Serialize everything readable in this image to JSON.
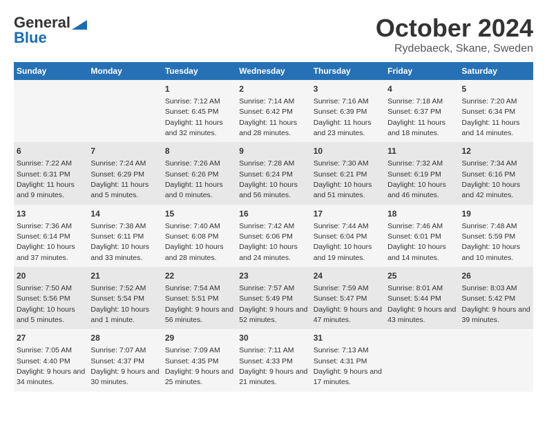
{
  "header": {
    "logo_general": "General",
    "logo_blue": "Blue",
    "month": "October 2024",
    "location": "Rydebaeck, Skane, Sweden"
  },
  "days_of_week": [
    "Sunday",
    "Monday",
    "Tuesday",
    "Wednesday",
    "Thursday",
    "Friday",
    "Saturday"
  ],
  "weeks": [
    [
      {
        "day": "",
        "info": ""
      },
      {
        "day": "",
        "info": ""
      },
      {
        "day": "1",
        "info": "Sunrise: 7:12 AM\nSunset: 6:45 PM\nDaylight: 11 hours and 32 minutes."
      },
      {
        "day": "2",
        "info": "Sunrise: 7:14 AM\nSunset: 6:42 PM\nDaylight: 11 hours and 28 minutes."
      },
      {
        "day": "3",
        "info": "Sunrise: 7:16 AM\nSunset: 6:39 PM\nDaylight: 11 hours and 23 minutes."
      },
      {
        "day": "4",
        "info": "Sunrise: 7:18 AM\nSunset: 6:37 PM\nDaylight: 11 hours and 18 minutes."
      },
      {
        "day": "5",
        "info": "Sunrise: 7:20 AM\nSunset: 6:34 PM\nDaylight: 11 hours and 14 minutes."
      }
    ],
    [
      {
        "day": "6",
        "info": "Sunrise: 7:22 AM\nSunset: 6:31 PM\nDaylight: 11 hours and 9 minutes."
      },
      {
        "day": "7",
        "info": "Sunrise: 7:24 AM\nSunset: 6:29 PM\nDaylight: 11 hours and 5 minutes."
      },
      {
        "day": "8",
        "info": "Sunrise: 7:26 AM\nSunset: 6:26 PM\nDaylight: 11 hours and 0 minutes."
      },
      {
        "day": "9",
        "info": "Sunrise: 7:28 AM\nSunset: 6:24 PM\nDaylight: 10 hours and 56 minutes."
      },
      {
        "day": "10",
        "info": "Sunrise: 7:30 AM\nSunset: 6:21 PM\nDaylight: 10 hours and 51 minutes."
      },
      {
        "day": "11",
        "info": "Sunrise: 7:32 AM\nSunset: 6:19 PM\nDaylight: 10 hours and 46 minutes."
      },
      {
        "day": "12",
        "info": "Sunrise: 7:34 AM\nSunset: 6:16 PM\nDaylight: 10 hours and 42 minutes."
      }
    ],
    [
      {
        "day": "13",
        "info": "Sunrise: 7:36 AM\nSunset: 6:14 PM\nDaylight: 10 hours and 37 minutes."
      },
      {
        "day": "14",
        "info": "Sunrise: 7:38 AM\nSunset: 6:11 PM\nDaylight: 10 hours and 33 minutes."
      },
      {
        "day": "15",
        "info": "Sunrise: 7:40 AM\nSunset: 6:08 PM\nDaylight: 10 hours and 28 minutes."
      },
      {
        "day": "16",
        "info": "Sunrise: 7:42 AM\nSunset: 6:06 PM\nDaylight: 10 hours and 24 minutes."
      },
      {
        "day": "17",
        "info": "Sunrise: 7:44 AM\nSunset: 6:04 PM\nDaylight: 10 hours and 19 minutes."
      },
      {
        "day": "18",
        "info": "Sunrise: 7:46 AM\nSunset: 6:01 PM\nDaylight: 10 hours and 14 minutes."
      },
      {
        "day": "19",
        "info": "Sunrise: 7:48 AM\nSunset: 5:59 PM\nDaylight: 10 hours and 10 minutes."
      }
    ],
    [
      {
        "day": "20",
        "info": "Sunrise: 7:50 AM\nSunset: 5:56 PM\nDaylight: 10 hours and 5 minutes."
      },
      {
        "day": "21",
        "info": "Sunrise: 7:52 AM\nSunset: 5:54 PM\nDaylight: 10 hours and 1 minute."
      },
      {
        "day": "22",
        "info": "Sunrise: 7:54 AM\nSunset: 5:51 PM\nDaylight: 9 hours and 56 minutes."
      },
      {
        "day": "23",
        "info": "Sunrise: 7:57 AM\nSunset: 5:49 PM\nDaylight: 9 hours and 52 minutes."
      },
      {
        "day": "24",
        "info": "Sunrise: 7:59 AM\nSunset: 5:47 PM\nDaylight: 9 hours and 47 minutes."
      },
      {
        "day": "25",
        "info": "Sunrise: 8:01 AM\nSunset: 5:44 PM\nDaylight: 9 hours and 43 minutes."
      },
      {
        "day": "26",
        "info": "Sunrise: 8:03 AM\nSunset: 5:42 PM\nDaylight: 9 hours and 39 minutes."
      }
    ],
    [
      {
        "day": "27",
        "info": "Sunrise: 7:05 AM\nSunset: 4:40 PM\nDaylight: 9 hours and 34 minutes."
      },
      {
        "day": "28",
        "info": "Sunrise: 7:07 AM\nSunset: 4:37 PM\nDaylight: 9 hours and 30 minutes."
      },
      {
        "day": "29",
        "info": "Sunrise: 7:09 AM\nSunset: 4:35 PM\nDaylight: 9 hours and 25 minutes."
      },
      {
        "day": "30",
        "info": "Sunrise: 7:11 AM\nSunset: 4:33 PM\nDaylight: 9 hours and 21 minutes."
      },
      {
        "day": "31",
        "info": "Sunrise: 7:13 AM\nSunset: 4:31 PM\nDaylight: 9 hours and 17 minutes."
      },
      {
        "day": "",
        "info": ""
      },
      {
        "day": "",
        "info": ""
      }
    ]
  ]
}
